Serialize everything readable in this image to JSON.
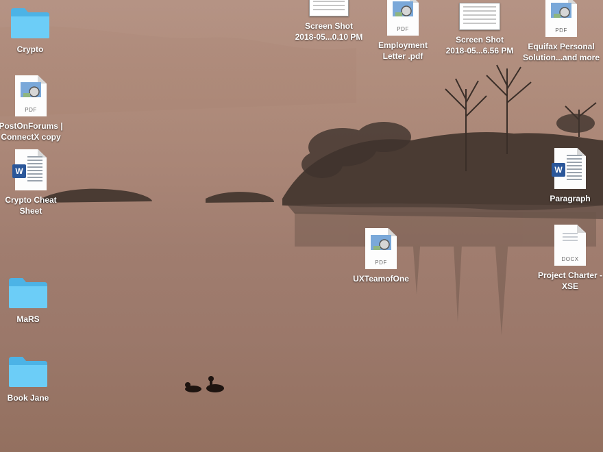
{
  "desktop": {
    "icons": [
      {
        "label": "Crypto",
        "kind": "folder"
      },
      {
        "label": "PostOnForums |\nConnectX copy",
        "kind": "pdf",
        "badge": "PDF"
      },
      {
        "label": "Crypto Cheat\nSheet",
        "kind": "word",
        "badge_letter": "W"
      },
      {
        "label": "MaRS",
        "kind": "folder"
      },
      {
        "label": "Book Jane",
        "kind": "folder"
      },
      {
        "label": "Screen Shot\n2018-05...0.10 PM",
        "kind": "screenshot"
      },
      {
        "label": "Employment\nLetter .pdf",
        "kind": "pdf",
        "badge": "PDF"
      },
      {
        "label": "Screen Shot\n2018-05...6.56 PM",
        "kind": "screenshot"
      },
      {
        "label": "Equifax Personal\nSolution...and more",
        "kind": "pdf",
        "badge": "PDF"
      },
      {
        "label": "Paragraph",
        "kind": "word",
        "badge_letter": "W"
      },
      {
        "label": "UXTeamofOne",
        "kind": "pdf",
        "badge": "PDF"
      },
      {
        "label": "Project Charter -\nXSE",
        "kind": "docx",
        "badge": "DOCX"
      }
    ]
  },
  "colors": {
    "folder": "#5ec3f2",
    "word_blue": "#2b579a",
    "wallpaper_top": "#b39180",
    "wallpaper_bottom": "#93705f"
  }
}
